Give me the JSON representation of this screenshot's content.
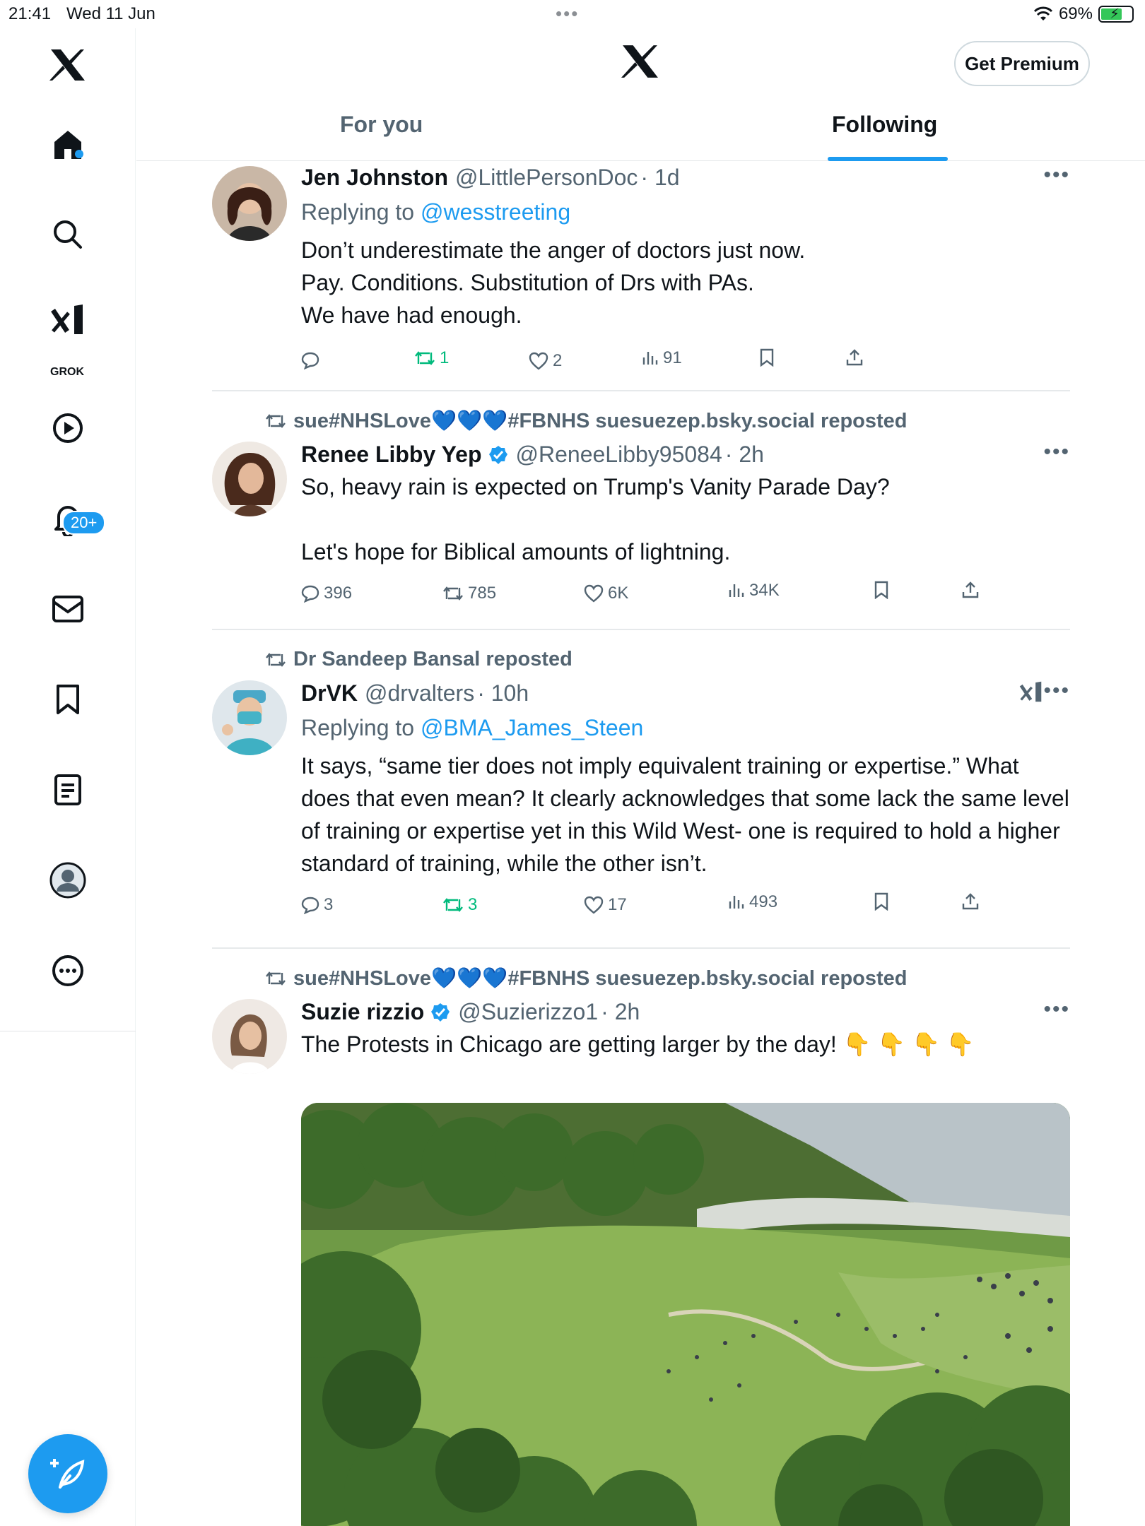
{
  "status_bar": {
    "time": "21:41",
    "date": "Wed 11 Jun",
    "battery": "69%"
  },
  "sidebar": {
    "grok_label": "GROK",
    "notifications_badge": "20+"
  },
  "header": {
    "premium_button": "Get Premium",
    "tabs": [
      {
        "label": "For you"
      },
      {
        "label": "Following"
      }
    ]
  },
  "tweets": [
    {
      "name": "Jen Johnston",
      "handle": "@LittlePersonDoc",
      "time": "· 1d",
      "reply_prefix": "Replying to ",
      "reply_to": "@wesstreeting",
      "text": "Don’t underestimate the anger of doctors just now.\nPay. Conditions. Substitution of Drs with PAs.\nWe have had enough.",
      "replies": "",
      "reposts": "1",
      "likes": "2",
      "views": "91"
    },
    {
      "repost_by": "sue#NHSLove💙💙💙#FBNHS suesuezep.bsky.social reposted",
      "name": "Renee Libby Yep",
      "handle": "@ReneeLibby95084",
      "time": "· 2h",
      "text": "So, heavy rain is expected on Trump's Vanity Parade Day?\n\nLet's hope for Biblical amounts of lightning.",
      "replies": "396",
      "reposts": "785",
      "likes": "6K",
      "views": "34K"
    },
    {
      "repost_by": "Dr Sandeep Bansal reposted",
      "name": "DrVK",
      "handle": "@drvalters",
      "time": "· 10h",
      "reply_prefix": "Replying to ",
      "reply_to": "@BMA_James_Steen",
      "text": "It says, “same tier does not imply equivalent training or expertise.” What does that even mean? It clearly acknowledges that some lack the same level of training or expertise yet in this Wild West- one is required to hold a higher standard of training, while the other isn’t.",
      "replies": "3",
      "reposts": "3",
      "likes": "17",
      "views": "493"
    },
    {
      "repost_by": "sue#NHSLove💙💙💙#FBNHS suesuezep.bsky.social reposted",
      "name": "Suzie rizzio",
      "handle": "@Suzierizzo1",
      "time": "· 2h",
      "text": "The Protests in Chicago are getting larger by the day! 👇 👇 👇 👇"
    }
  ],
  "colors": {
    "accent": "#1d9bf0",
    "repost_green": "#00ba7c",
    "muted": "#536471",
    "text": "#0f1419"
  }
}
